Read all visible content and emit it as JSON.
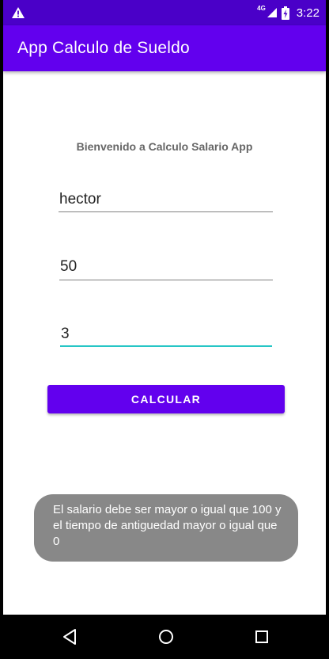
{
  "status_bar": {
    "network_label": "4G",
    "time": "3:22",
    "icons": [
      "warning-icon",
      "signal-icon",
      "battery-charging-icon"
    ]
  },
  "app_bar": {
    "title": "App Calculo de Sueldo"
  },
  "form": {
    "welcome": "Bienvenido a Calculo Salario App",
    "name_value": "hector",
    "salary_value": "50",
    "seniority_value": "3",
    "calculate_label": "CALCULAR"
  },
  "toast": {
    "message": "El salario debe ser mayor o igual que 100 y el tiempo de antiguedad mayor o igual que 0"
  },
  "nav_bar": {
    "icons": [
      "back-icon",
      "home-icon",
      "recents-icon"
    ]
  },
  "colors": {
    "primary": "#6200ee",
    "primary_dark": "#4a00c8",
    "accent": "#26c6c6",
    "toast_bg": "#888888"
  }
}
